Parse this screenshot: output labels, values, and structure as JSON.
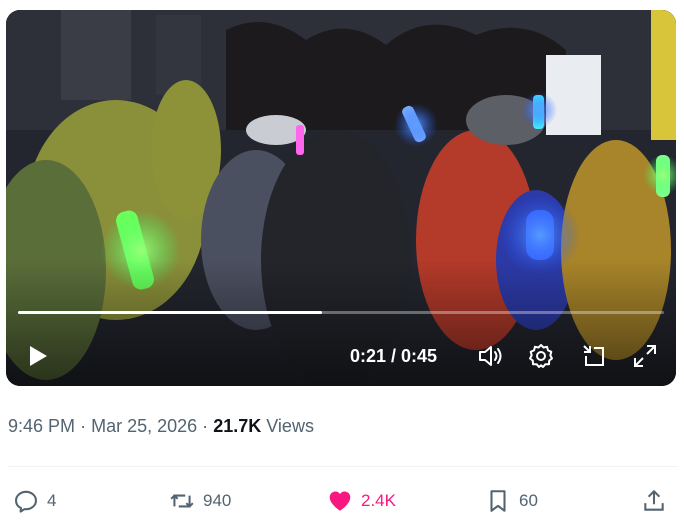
{
  "video": {
    "current_time": "0:21",
    "duration": "0:45",
    "time_display": "0:21 / 0:45",
    "progress_fraction": 0.47
  },
  "post_meta": {
    "time": "9:46 PM",
    "separator": "·",
    "date": "Mar 25, 2026",
    "views_count": "21.7K",
    "views_label": "Views"
  },
  "actions": {
    "replies": "4",
    "reposts": "940",
    "likes": "2.4K",
    "bookmarks": "60"
  },
  "colors": {
    "like_active": "#f91880",
    "muted_text": "#536471"
  },
  "icons": [
    "play-icon",
    "volume-icon",
    "settings-icon",
    "popout-icon",
    "fullscreen-icon",
    "reply-icon",
    "repost-icon",
    "heart-icon",
    "bookmark-icon",
    "share-icon"
  ]
}
